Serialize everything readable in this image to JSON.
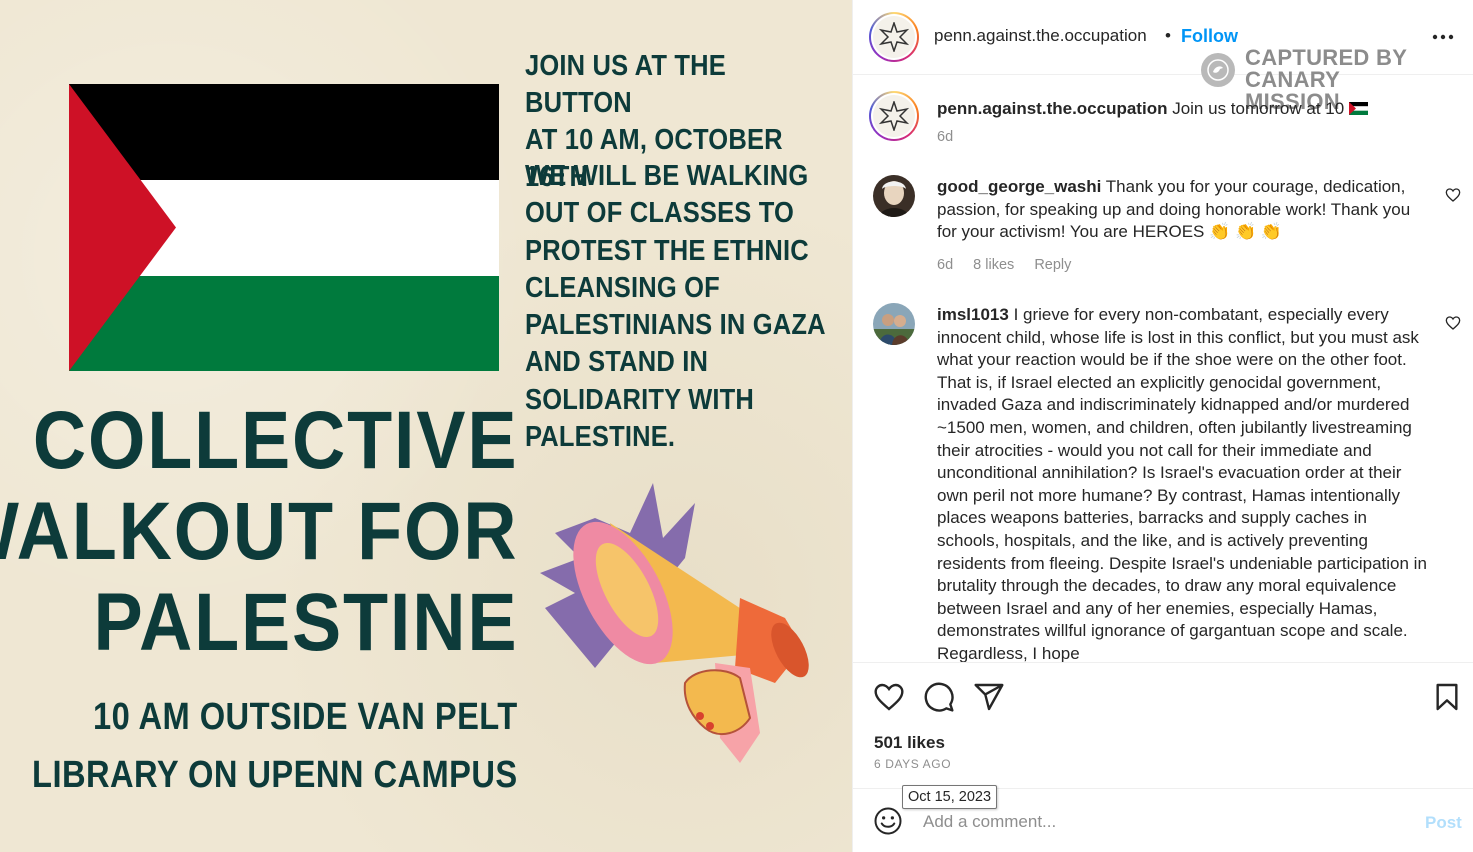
{
  "poster": {
    "join_text": "JOIN US  AT THE BUTTON\nAT 10 AM, OCTOBER 16TH",
    "walk_lines": [
      "WE WILL BE WALKING",
      "OUT OF CLASSES TO",
      "PROTEST THE ETHNIC",
      "CLEANSING OF",
      "PALESTINIANS IN GAZA",
      "AND STAND IN",
      "SOLIDARITY WITH",
      "PALESTINE."
    ],
    "headline_lines": [
      "COLLECTIVE",
      "WALKOUT FOR",
      "PALESTINE"
    ],
    "sub_lines": [
      "10 AM OUTSIDE VAN PELT",
      "LIBRARY ON UPENN CAMPUS"
    ],
    "colors": {
      "background": "#efe7d3",
      "text": "#0d3b3a",
      "flag_black": "#000000",
      "flag_white": "#ffffff",
      "flag_green": "#007a3d",
      "flag_red": "#ce1126"
    }
  },
  "header": {
    "username": "penn.against.the.occupation",
    "separator": "•",
    "follow_label": "Follow",
    "more_icon": "more-horizontal-icon"
  },
  "watermark": {
    "text": "CAPTURED BY\nCANARY MISSION"
  },
  "caption": {
    "username": "penn.against.the.occupation",
    "text": "Join us tomorrow at 10",
    "emoji": "palestine-flag-emoji",
    "time": "6d"
  },
  "comments": [
    {
      "username": "good_george_washi",
      "text": "Thank you for your courage, dedication, passion, for speaking up and doing honorable work! Thank you for your activism! You are HEROES 👏 👏 👏",
      "time": "6d",
      "likes": "8 likes",
      "reply": "Reply"
    },
    {
      "username": "imsl1013",
      "text": "I grieve for every non-combatant, especially every innocent child, whose life is lost in this conflict, but you must ask what your reaction would be if the shoe were on the other foot. That is, if Israel elected an explicitly genocidal government, invaded Gaza and indiscriminately kidnapped and/or murdered ~1500 men, women, and children, often jubilantly livestreaming their atrocities - would you not call for their immediate and unconditional annihilation? Is Israel's evacuation order at their own peril not more humane? By contrast, Hamas intentionally places weapons batteries, barracks and supply caches in schools, hospitals, and the like, and is actively preventing residents from fleeing. Despite Israel's undeniable participation in brutality through the decades, to draw any moral equivalence between Israel and any of her enemies, especially Hamas, demonstrates willful ignorance of gargantuan scope and scale. Regardless, I hope"
    }
  ],
  "actions": {
    "like_icon": "heart-icon",
    "comment_icon": "comment-icon",
    "share_icon": "share-icon",
    "save_icon": "bookmark-icon",
    "likes": "501 likes",
    "date": "6 DAYS AGO"
  },
  "add_comment": {
    "placeholder": "Add a comment...",
    "post_label": "Post",
    "emoji_icon": "emoji-icon"
  },
  "tooltip": {
    "text": "Oct 15, 2023"
  },
  "accent_colors": {
    "follow": "#0095f6",
    "post_disabled": "#b2dffc",
    "muted": "#8e8e8e"
  }
}
